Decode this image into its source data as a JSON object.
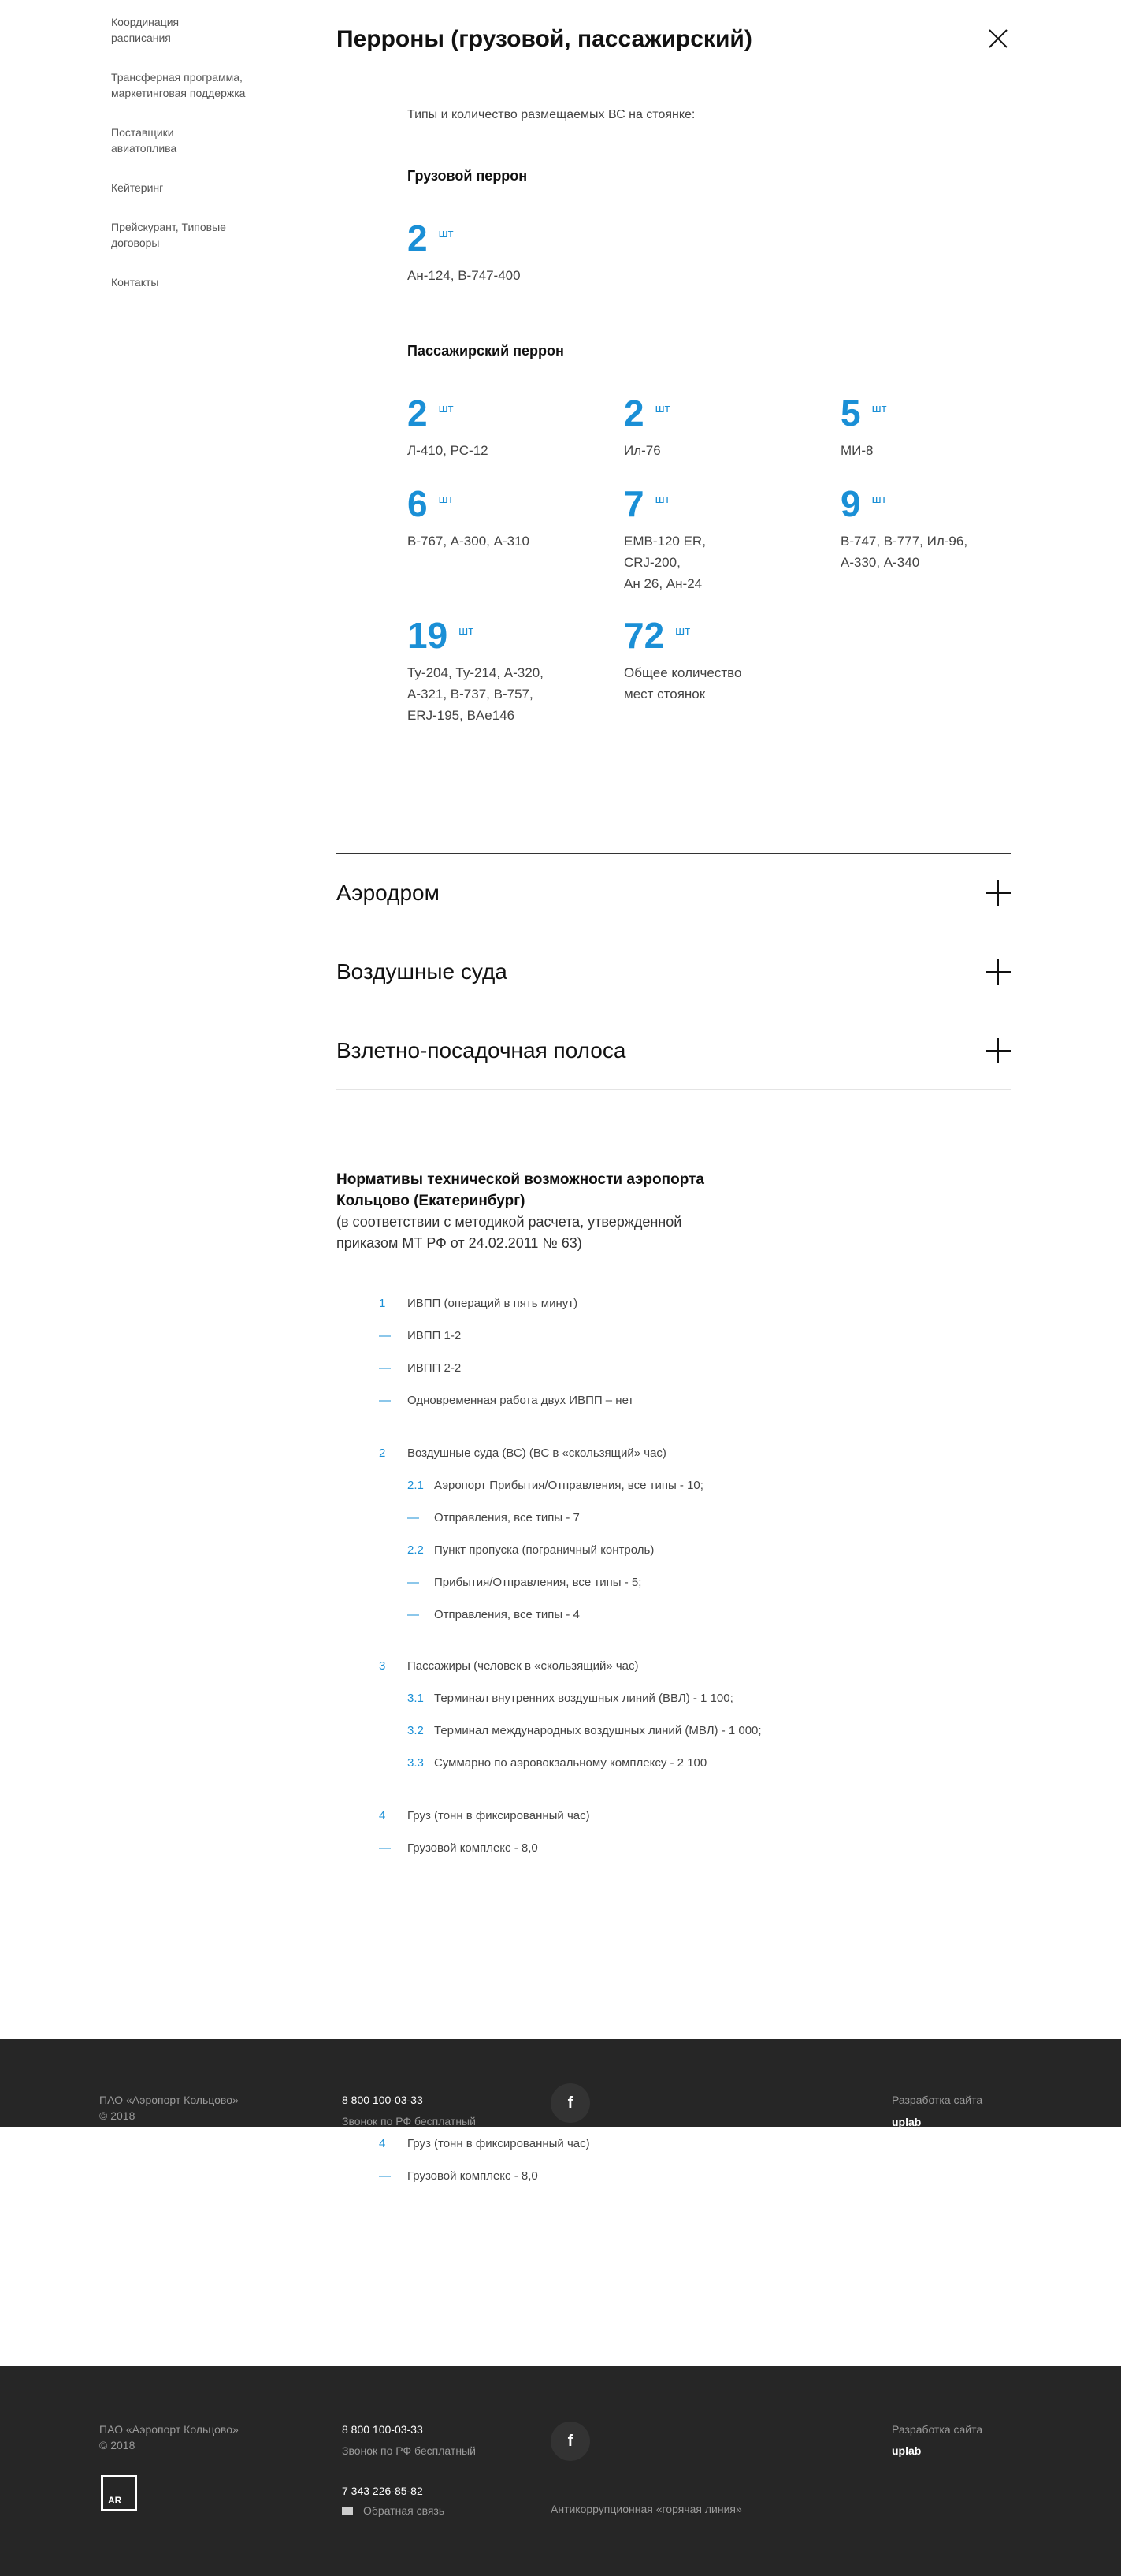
{
  "sidebar": {
    "items": [
      {
        "label": "Координация расписания"
      },
      {
        "label": "Трансферная программа, маркетинговая поддержка"
      },
      {
        "label": "Поставщики авиатоплива"
      },
      {
        "label": "Кейтеринг"
      },
      {
        "label": "Прейскурант, Типовые договоры"
      },
      {
        "label": "Контакты"
      }
    ]
  },
  "header": {
    "title": "Перроны (грузовой, пассажирский)"
  },
  "intro": "Типы и количество размещаемых ВС на стоянке:",
  "cargo": {
    "title": "Грузовой перрон",
    "stat": {
      "num": "2",
      "unit": "шт",
      "desc": "Ан-124, В-747-400"
    }
  },
  "passenger": {
    "title": "Пассажирский перрон",
    "stats": [
      {
        "num": "2",
        "unit": "шт",
        "desc": "Л-410, РС-12"
      },
      {
        "num": "2",
        "unit": "шт",
        "desc": "Ил-76"
      },
      {
        "num": "5",
        "unit": "шт",
        "desc": "МИ-8"
      },
      {
        "num": "6",
        "unit": "шт",
        "desc": "В-767, А-300, А-310"
      },
      {
        "num": "7",
        "unit": "шт",
        "desc": "EMB-120 ER,\nCRJ-200,\nАн 26, Ан-24"
      },
      {
        "num": "9",
        "unit": "шт",
        "desc": "В-747, В-777, Ил-96,\nА-330, А-340"
      },
      {
        "num": "19",
        "unit": "шт",
        "desc": "Ту-204, Ту-214, А-320,\nА-321, В-737, В-757,\nERJ-195, BAe146"
      },
      {
        "num": "72",
        "unit": "шт",
        "desc": "Общее количество\nмест стоянок"
      }
    ]
  },
  "accordion": [
    {
      "label": "Аэродром"
    },
    {
      "label": "Воздушные суда"
    },
    {
      "label": "Взлетно-посадочная полоса"
    }
  ],
  "norms": {
    "title": "Нормативы технической возможности аэропорта Кольцово (Екатеринбург)",
    "subtitle": "(в соответствии с методикой расчета, утвержденной приказом МТ РФ от 24.02.2011 № 63)",
    "rows": [
      {
        "marker": "1",
        "text": "ИВПП (операций в пять минут)"
      },
      {
        "marker": "—",
        "text": "ИВПП 1-2"
      },
      {
        "marker": "—",
        "text": "ИВПП 2-2"
      },
      {
        "marker": "—",
        "text": "Одновременная работа двух ИВПП – нет"
      },
      {
        "marker": "2",
        "text": "Воздушные суда (ВС) (ВС в «скользящий» час)"
      },
      {
        "marker": "2.1",
        "text": "Аэропорт Прибытия/Отправления, все типы - 10;"
      },
      {
        "marker": "—",
        "text": "Отправления, все типы - 7"
      },
      {
        "marker": "2.2",
        "text": "Пункт пропуска (пограничный контроль)"
      },
      {
        "marker": "—",
        "text": "Прибытия/Отправления, все типы - 5;"
      },
      {
        "marker": "—",
        "text": "Отправления, все типы - 4"
      },
      {
        "marker": "3",
        "text": "Пассажиры (человек в «скользящий» час)"
      },
      {
        "marker": "3.1",
        "text": "Терминал внутренних воздушных линий (ВВЛ)  - 1 100;"
      },
      {
        "marker": "3.2",
        "text": "Терминал международных воздушных линий (МВЛ) - 1 000;"
      },
      {
        "marker": "3.3",
        "text": "Суммарно по аэровокзальному комплексу  - 2 100"
      },
      {
        "marker": "4",
        "text": "Груз (тонн в фиксированный час)"
      },
      {
        "marker": "—",
        "text": "Грузовой комплекс -  8,0"
      }
    ]
  },
  "footer": {
    "company": "ПАО «Аэропорт Кольцово»",
    "year": "© 2018",
    "phone": "8 800 100-03-33",
    "phone_note": "Звонок по РФ бесплатный",
    "phone2": "7 343 226-85-82",
    "feedback": "Обратная связь",
    "facebook": "f",
    "anticorruption": "Антикоррупционная «горячая линия»",
    "dev_label": "Разработка сайта",
    "dev_name": "uplab",
    "logo_text": "AR"
  },
  "colors": {
    "accent": "#1a8fd6",
    "footer_bg": "#262626"
  }
}
